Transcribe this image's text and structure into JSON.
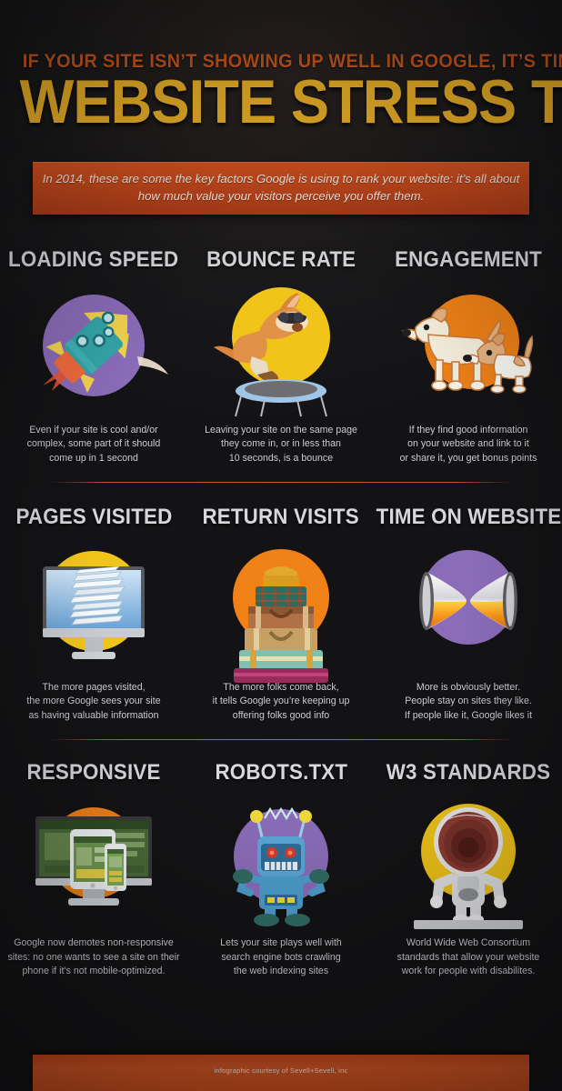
{
  "header": {
    "kicker": "IF YOUR SITE ISN’T SHOWING UP WELL IN GOOGLE, IT’S TIME FOR A",
    "title": "WEBSITE STRESS TEST"
  },
  "banner": {
    "text": "In 2014, these are some the key factors Google is using to rank your website: it’s all about how much value your visitors perceive you offer them."
  },
  "colors": {
    "title_yellow": "#f0b428",
    "kicker_orange": "#c9591f",
    "banner_orange": "#c1471c",
    "circle_purple": "#8a6cb8",
    "circle_yellow": "#f0c419",
    "circle_orange": "#ef8117",
    "divider": "#b6563a",
    "body_text": "#cfcfd6",
    "heading_text": "#d7d7dc"
  },
  "rows": [
    {
      "cells": [
        {
          "title": "LOADING SPEED",
          "icon": "rocket-icon",
          "circle_color": "#8a6cb8",
          "desc": "Even if your site is cool and/or\ncomplex, some part of it should\ncome up in 1 second"
        },
        {
          "title": "BOUNCE RATE",
          "icon": "kangaroo-trampoline-icon",
          "circle_color": "#f0c419",
          "desc": "Leaving your site on the same page\nthey come in, or in less than\n10 seconds, is a bounce"
        },
        {
          "title": "ENGAGEMENT",
          "icon": "two-dogs-icon",
          "circle_color": "#ef8117",
          "desc": "If they find good information\non your website and link to it\nor share it, you get bonus points"
        }
      ]
    },
    {
      "cells": [
        {
          "title": "PAGES VISITED",
          "icon": "monitor-pages-icon",
          "circle_color": "#f0c419",
          "desc": "The more pages visited,\nthe more Google sees your site\nas having valuable information"
        },
        {
          "title": "RETURN VISITS",
          "icon": "suitcases-icon",
          "circle_color": "#ef8117",
          "desc": "The more folks come back,\nit tells Google you’re keeping up\noffering folks good info"
        },
        {
          "title": "TIME ON WEBSITE",
          "icon": "hourglass-icon",
          "circle_color": "#8a6cb8",
          "desc": "More is obviously better.\nPeople stay on sites they like.\nIf people like it, Google likes it"
        }
      ]
    },
    {
      "cells": [
        {
          "title": "RESPONSIVE",
          "icon": "devices-icon",
          "circle_color": "#ef8117",
          "desc": "Google now demotes non-responsive\nsites: no one wants to see a site on their\nphone if it’s not mobile-optimized."
        },
        {
          "title": "ROBOTS.TXT",
          "icon": "robot-icon",
          "circle_color": "#8a6cb8",
          "desc": "Lets your site plays well with\nsearch engine bots crawling\nthe web indexing sites"
        },
        {
          "title": "W3 STANDARDS",
          "icon": "astronaut-icon",
          "circle_color": "#f0c419",
          "desc": "World Wide Web Consortium\nstandards that allow your website\nwork for people with disabilites."
        }
      ]
    }
  ],
  "footer": {
    "credit": "infographic courtesy of Sevell+Sevell, inc"
  }
}
